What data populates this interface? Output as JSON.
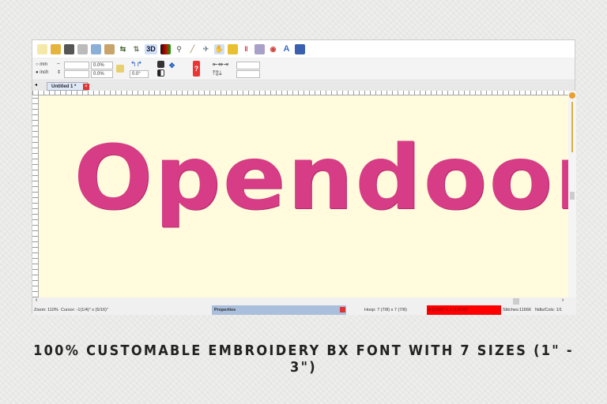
{
  "toolbar": {
    "icons": [
      "new-icon",
      "open-icon",
      "save-icon",
      "print-icon",
      "copy-icon",
      "paste-icon",
      "mirror-icon",
      "flip-icon",
      "3d-icon",
      "color-icon",
      "zoom-icon",
      "measure-icon",
      "hoop-icon",
      "hand-icon",
      "frame-icon",
      "thread-icon",
      "palette-icon",
      "stitch-icon",
      "text-icon",
      "export-icon"
    ],
    "label_3d": "3D",
    "label_text": "A"
  },
  "size_panel": {
    "unit_mm": "mm",
    "unit_inch": "inch",
    "width_value": "",
    "height_value": "",
    "width_pct": "0.0%",
    "height_pct": "0.0%",
    "rotation": "0.0°",
    "selected_unit": "inch"
  },
  "tabs": [
    {
      "label": "Untitled 1 *"
    }
  ],
  "design": {
    "text": "Opendoor",
    "color": "#d63d86"
  },
  "status": {
    "zoom": "Zoom: 110%",
    "cursor": "Cursor: -1(1/4)\" x (5/16)\"",
    "properties": "Properties",
    "hoop": "Hoop: 7 (7/8) x 7 (7/8)",
    "size": "8 (1/16)\" x 1 (13/16)\"",
    "stitches": "Stitches:11666",
    "ndls": "Ndls/Cols: 1/1"
  },
  "caption": "100% CUSTOMABLE EMBROIDERY BX FONT WITH 7 SIZES (1\" -  3\")"
}
